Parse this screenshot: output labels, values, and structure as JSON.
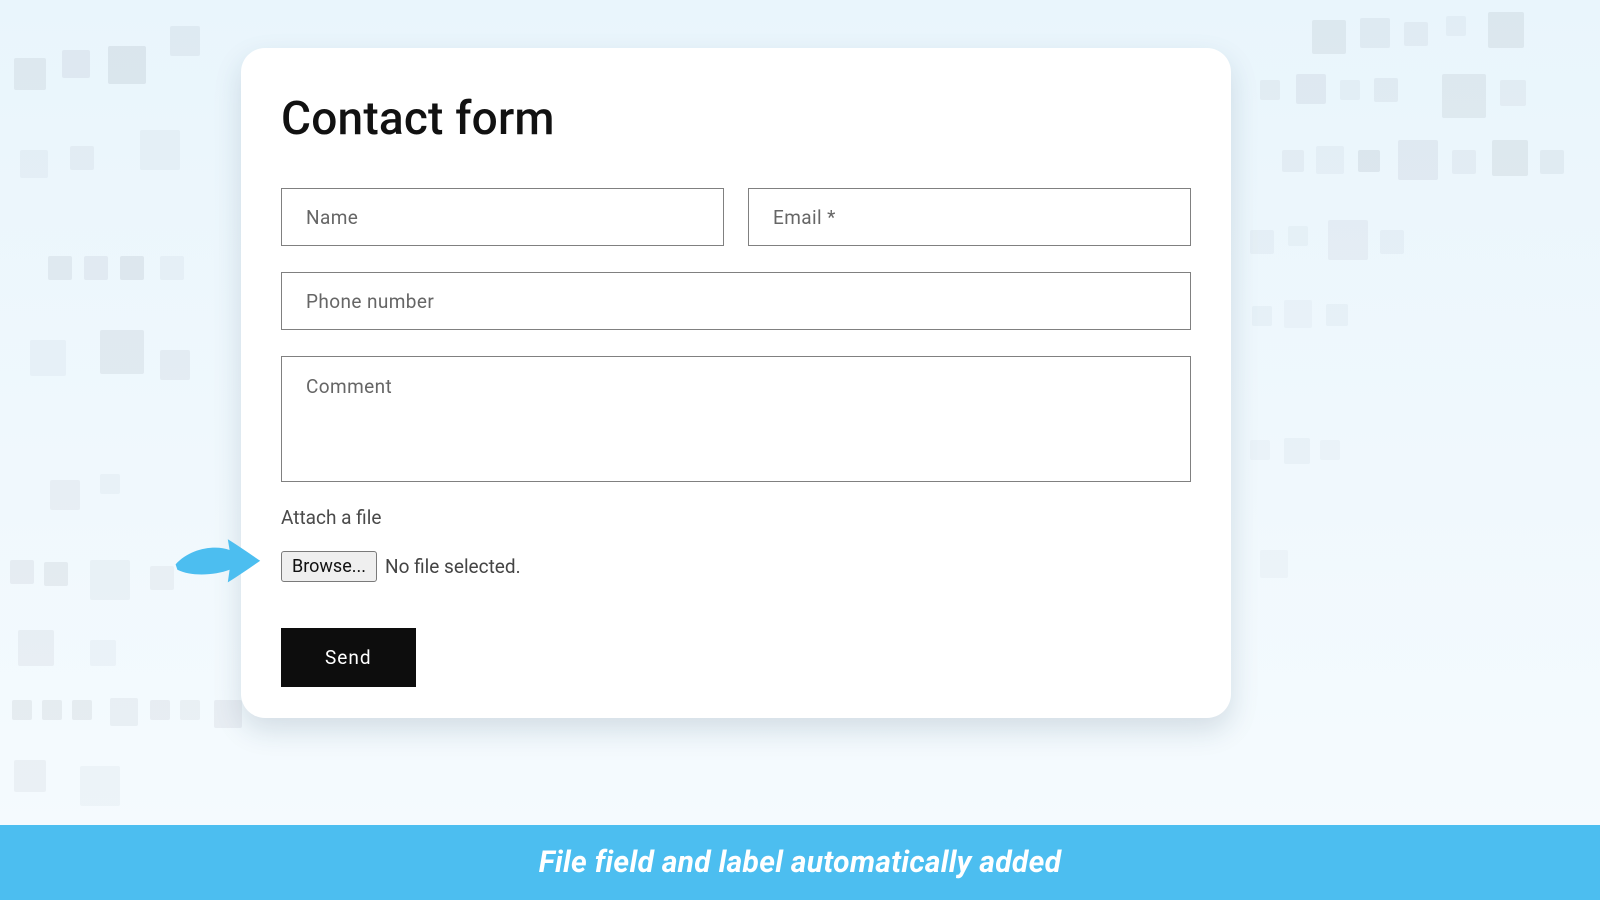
{
  "form": {
    "title": "Contact form",
    "name_placeholder": "Name",
    "email_placeholder": "Email *",
    "phone_placeholder": "Phone number",
    "comment_placeholder": "Comment",
    "attach_label": "Attach a file",
    "browse_label": "Browse...",
    "no_file_text": "No file selected.",
    "submit_label": "Send"
  },
  "banner": {
    "text": "File field and label automatically added"
  },
  "colors": {
    "accent": "#4cbef0",
    "card_bg": "#ffffff",
    "submit_bg": "#0d0d0d"
  }
}
